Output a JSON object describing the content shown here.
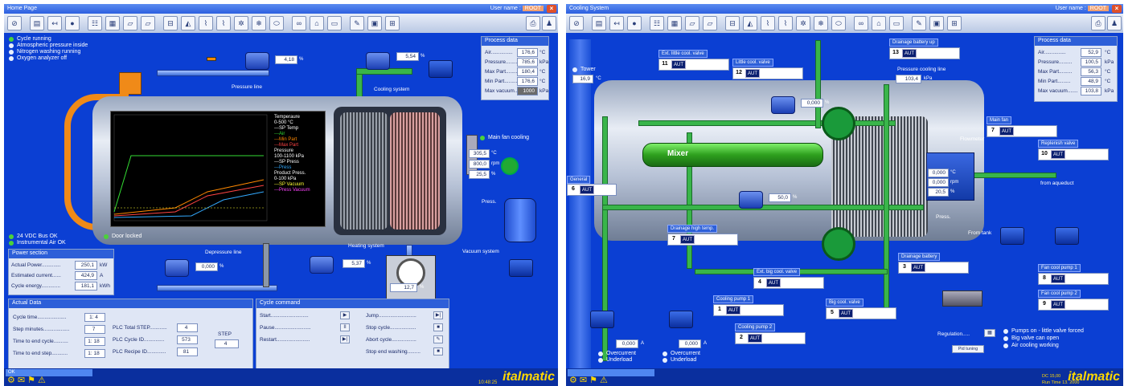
{
  "left": {
    "title": "Home Page",
    "user_label": "User name :",
    "user_value": "ROOT",
    "status": [
      "Cycle running",
      "Atmospheric pressure inside",
      "Nitrogen washing running",
      "Oxygen analyzer off"
    ],
    "status_bottom": [
      "24 VDC Bus OK",
      "Instrumental Air OK"
    ],
    "door_locked": "Door locked",
    "main_fan_cooling": "Main fan cooling",
    "labels": {
      "pressure_line": "Pressure line",
      "cooling_system": "Cooling system",
      "depressure_line": "Depressure line",
      "heating_system": "Heating system",
      "vacuum_system": "Vacuum system",
      "press": "Press."
    },
    "values": {
      "pressure_line": "4,18",
      "cooling_system": "5,54",
      "depressure_line": "0,000",
      "heating_system": "5,37",
      "gauge": "12,7",
      "fan_1": "305,5",
      "fan_2": "800,0",
      "fan_3": "25,5"
    },
    "value_units": {
      "pressure_line": "%",
      "cooling_system": "%",
      "depressure_line": "%",
      "heating_system": "%",
      "gauge": "%",
      "fan_1": "°C",
      "fan_2": "rpm",
      "fan_3": "%"
    },
    "trend_legend": [
      "Temperaure",
      "0-500 °C",
      "---SP Temp",
      "---Air",
      "---Min Part",
      "---Max Part",
      "Pressure",
      "100-1100 kPa",
      "---SP Press",
      "---Press",
      "Product Press.",
      "0-100 kPa",
      "---SP Vacuum",
      "---Press Vacuum"
    ],
    "trend_legend_colors": [
      "#ffffff",
      "#ffffff",
      "#ffffff",
      "#33dd33",
      "#ff8800",
      "#ff4444",
      "#ffffff",
      "#ffffff",
      "#ffffff",
      "#33aaff",
      "#ffffff",
      "#ffffff",
      "#ffff33",
      "#ff44ff"
    ],
    "process_data": {
      "title": "Process data",
      "rows": [
        {
          "label": "Air...............",
          "value": "176,6",
          "unit": "°C"
        },
        {
          "label": "Pressure.........",
          "value": "785,6",
          "unit": "kPa"
        },
        {
          "label": "Max Part.........",
          "value": "180,4",
          "unit": "°C"
        },
        {
          "label": "Min Part.........",
          "value": "176,6",
          "unit": "°C"
        },
        {
          "label": "Max vacuum.......",
          "value": "1000",
          "unit": "kPa"
        }
      ]
    },
    "power_section": {
      "title": "Power section",
      "rows": [
        {
          "label": "Actual Power.............",
          "value": "250,1",
          "unit": "kW"
        },
        {
          "label": "Estimated current......",
          "value": "424,9",
          "unit": "A"
        },
        {
          "label": "Cycle energy.............",
          "value": "181,1",
          "unit": "kWh"
        }
      ]
    },
    "actual_data": {
      "title": "Actual Data",
      "rows": [
        {
          "label": "Cycle time....................",
          "value": "1:  4"
        },
        {
          "label": "Step minutes..................",
          "value": "7"
        },
        {
          "label": "Time to end cycle..........",
          "value": "1: 18"
        },
        {
          "label": "Time to end step...........",
          "value": "1: 18"
        }
      ],
      "rows2": [
        {
          "label": "PLC Total STEP............",
          "value": "4"
        },
        {
          "label": "PLC Cycle ID..............",
          "value": "573"
        },
        {
          "label": "PLC Recipe ID.............",
          "value": "81"
        }
      ],
      "step_label": "STEP",
      "step_value": "4"
    },
    "cycle_command": {
      "title": "Cycle command",
      "rows": [
        {
          "label": "Start..........................",
          "icon": "▶"
        },
        {
          "label": "Pause.........................",
          "icon": "II"
        },
        {
          "label": "Restart.......................",
          "icon": "▶|"
        }
      ],
      "rows2": [
        {
          "label": "Jump..........................",
          "icon": "▶|"
        },
        {
          "label": "Stop cycle..................",
          "icon": "■"
        },
        {
          "label": "Abort cycle.................",
          "icon": "✎"
        },
        {
          "label": "Stop end washing.........",
          "icon": "■"
        }
      ]
    },
    "statusbar": "OK",
    "brand": "italmatic",
    "clock": "10:48:25"
  },
  "right": {
    "title": "Cooling System",
    "user_label": "User name :",
    "user_value": "ROOT",
    "tower": {
      "label": "Tower",
      "value": "16,9",
      "unit": "°C"
    },
    "mixer": "Mixer",
    "general": {
      "title": "General",
      "num": "6",
      "auto": "AUT"
    },
    "controls": [
      {
        "title": "Ext. little cool. valve",
        "num": "11",
        "auto": "AUT"
      },
      {
        "title": "Little cool. valve",
        "num": "12",
        "auto": "AUT"
      },
      {
        "title": "Drainage battery up",
        "num": "13",
        "auto": "AUT"
      },
      {
        "title": "Main fan",
        "num": "7",
        "auto": "AUT"
      },
      {
        "title": "Replenish valve",
        "num": "10",
        "auto": "AUT"
      },
      {
        "title": "Drainage high temp.",
        "num": "7",
        "auto": "AUT"
      },
      {
        "title": "Ext. big cool. valve",
        "num": "4",
        "auto": "AUT"
      },
      {
        "title": "Drainage battery",
        "num": "3",
        "auto": "AUT"
      },
      {
        "title": "Fan cool pump 1",
        "num": "8",
        "auto": "AUT"
      },
      {
        "title": "Fan cool pump 2",
        "num": "9",
        "auto": "AUT"
      },
      {
        "title": "Cooling pump 1",
        "num": "1",
        "auto": "AUT"
      },
      {
        "title": "Big cool. valve",
        "num": "5",
        "auto": "AUT"
      },
      {
        "title": "Cooling pump 2",
        "num": "2",
        "auto": "AUT"
      }
    ],
    "pressure_cooling_line": {
      "label": "Pressure cooling line",
      "value": "103,4",
      "unit": "kPa"
    },
    "flowmeter": "Flowmeter",
    "valve_values": {
      "v12": "0,000",
      "v5": "50,0"
    },
    "valve_units": {
      "v12": "%",
      "v5": "%"
    },
    "fan_values": [
      "0,000",
      "0,000",
      "20,5"
    ],
    "fan_units": [
      "°C",
      "rpm",
      "%"
    ],
    "labels": {
      "from_aqueduct": "from aqueduct",
      "from_tank": "From tank",
      "press": "Press."
    },
    "pump_values": [
      {
        "value": "0,000",
        "unit": "A"
      },
      {
        "value": "0,000",
        "unit": "A"
      }
    ],
    "pump_status": [
      [
        "Overcurrent",
        "Underload"
      ],
      [
        "Overcurrent",
        "Underload"
      ]
    ],
    "process_data": {
      "title": "Process data",
      "rows": [
        {
          "label": "Air...............",
          "value": "52,9",
          "unit": "°C"
        },
        {
          "label": "Pressure.........",
          "value": "100,5",
          "unit": "kPa"
        },
        {
          "label": "Max Part.........",
          "value": "56,3",
          "unit": "°C"
        },
        {
          "label": "Min Part.........",
          "value": "48,9",
          "unit": "°C"
        },
        {
          "label": "Max vacuum.......",
          "value": "103,8",
          "unit": "kPa"
        }
      ]
    },
    "regulation": {
      "label": "Regulation.....",
      "button": "Pid tuning"
    },
    "regulation_status": [
      "Pumps on - little valve forced",
      "Big valve can open",
      "Air cooling working"
    ],
    "brand": "italmatic",
    "status_lines": [
      "DC 15,00",
      "Run Time 13. 2000"
    ]
  }
}
